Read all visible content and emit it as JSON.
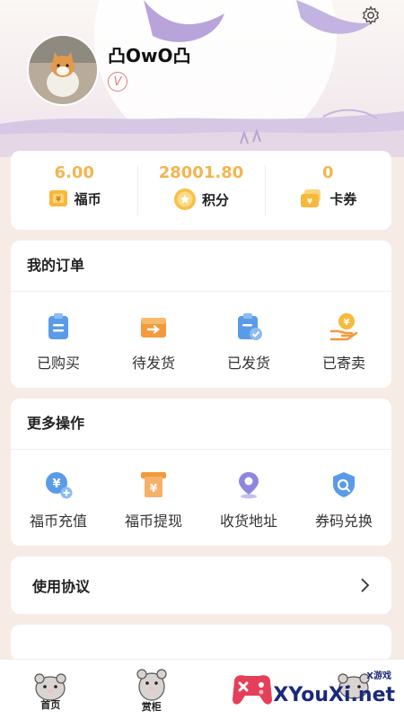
{
  "profile": {
    "username": "凸OwO凸",
    "badge": "V"
  },
  "stats": [
    {
      "value": "6.00",
      "label": "福币",
      "icon": "coin-card-icon"
    },
    {
      "value": "28001.80",
      "label": "积分",
      "icon": "points-star-icon"
    },
    {
      "value": "0",
      "label": "卡券",
      "icon": "coupon-icon"
    }
  ],
  "orders": {
    "title": "我的订单",
    "items": [
      {
        "label": "已购买",
        "icon": "clipboard-icon"
      },
      {
        "label": "待发货",
        "icon": "box-arrow-icon"
      },
      {
        "label": "已发货",
        "icon": "shipped-icon"
      },
      {
        "label": "已寄卖",
        "icon": "consign-icon"
      }
    ]
  },
  "more": {
    "title": "更多操作",
    "items": [
      {
        "label": "福币充值",
        "icon": "recharge-icon"
      },
      {
        "label": "福币提现",
        "icon": "withdraw-icon"
      },
      {
        "label": "收货地址",
        "icon": "location-icon"
      },
      {
        "label": "券码兑换",
        "icon": "redeem-icon"
      }
    ]
  },
  "agreement": {
    "label": "使用协议"
  },
  "tabs": [
    {
      "label": "首页"
    },
    {
      "label": "赏柜"
    },
    {
      "label": ""
    },
    {
      "label": ""
    }
  ],
  "watermark": {
    "small": "X游戏",
    "text": "XYouXi.net"
  },
  "colors": {
    "accent": "#f3b54e",
    "orange": "#f39a3c",
    "blue": "#5a9be8",
    "purple": "#b9a6db"
  }
}
